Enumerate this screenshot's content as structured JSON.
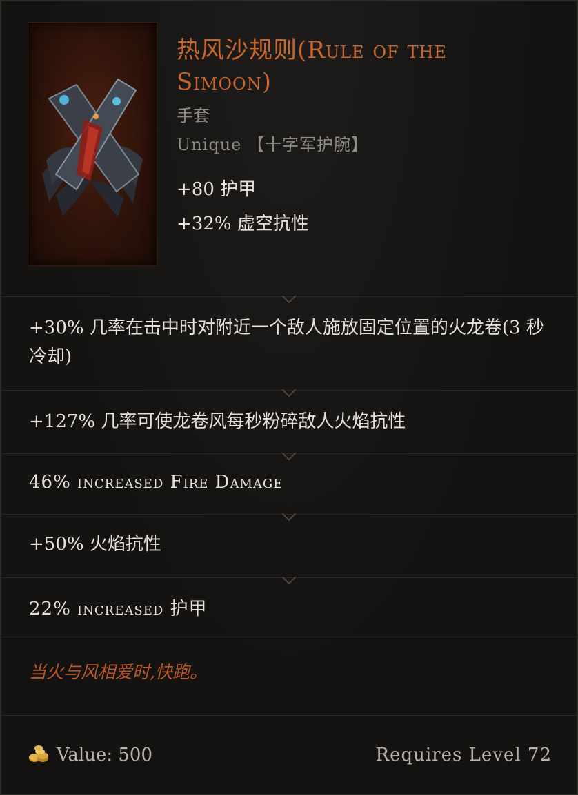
{
  "item": {
    "name": "热风沙规则(Rule of the Simoon)",
    "type": "手套",
    "rarity": "Unique 【十字军护腕】",
    "base_stats": [
      "+80 护甲",
      "+32% 虚空抗性"
    ]
  },
  "affixes": [
    "+30% 几率在击中时对附近一个敌人施放固定位置的火龙卷(3 秒冷却)",
    "+127% 几率可使龙卷风每秒粉碎敌人火焰抗性",
    "46% increased Fire Damage",
    "+50% 火焰抗性",
    "22% increased 护甲"
  ],
  "flavor_text": "当火与风相爱时,快跑。",
  "footer": {
    "value_label": "Value: 500",
    "requires_level": "Requires Level 72"
  },
  "icons": {
    "item": "gauntlets-icon",
    "gold": "gold-coins-icon"
  },
  "colors": {
    "name": "#c8662c",
    "flavor": "#b8582a",
    "muted": "#8f8c86"
  }
}
